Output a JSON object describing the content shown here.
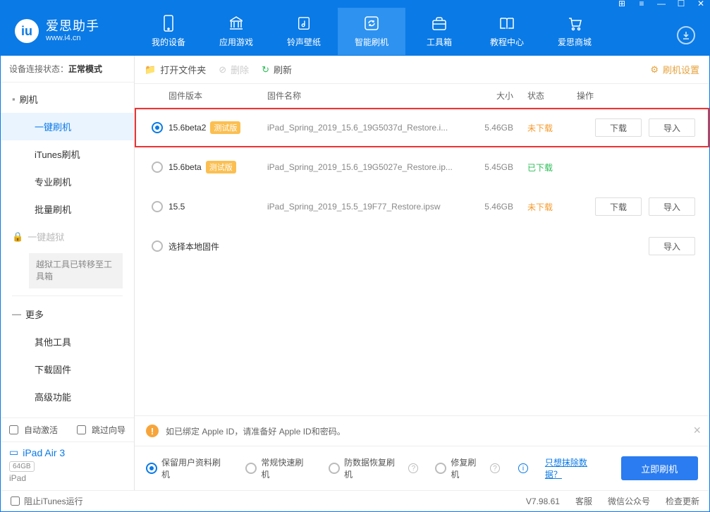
{
  "header": {
    "logo_cn": "爱思助手",
    "logo_url": "www.i4.cn",
    "nav": [
      {
        "label": "我的设备"
      },
      {
        "label": "应用游戏"
      },
      {
        "label": "铃声壁纸"
      },
      {
        "label": "智能刷机"
      },
      {
        "label": "工具箱"
      },
      {
        "label": "教程中心"
      },
      {
        "label": "爱思商城"
      }
    ]
  },
  "sidebar": {
    "status_prefix": "设备连接状态：",
    "status_value": "正常模式",
    "group_flash": "刷机",
    "items_flash": [
      "一键刷机",
      "iTunes刷机",
      "专业刷机",
      "批量刷机"
    ],
    "group_jailbreak": "一键越狱",
    "jailbreak_note": "越狱工具已转移至工具箱",
    "group_more": "更多",
    "items_more": [
      "其他工具",
      "下载固件",
      "高级功能"
    ],
    "cb_auto_activate": "自动激活",
    "cb_skip_guide": "跳过向导",
    "device_name": "iPad Air 3",
    "device_storage": "64GB",
    "device_type": "iPad"
  },
  "toolbar": {
    "open_folder": "打开文件夹",
    "delete": "删除",
    "refresh": "刷新",
    "settings": "刷机设置"
  },
  "table": {
    "head": {
      "version": "固件版本",
      "name": "固件名称",
      "size": "大小",
      "status": "状态",
      "ops": "操作"
    },
    "rows": [
      {
        "version": "15.6beta2",
        "beta": "测试版",
        "name": "iPad_Spring_2019_15.6_19G5037d_Restore.i...",
        "size": "5.46GB",
        "status": "未下载",
        "status_class": "undl",
        "selected": true,
        "highlight": true,
        "download": "下载",
        "import": "导入"
      },
      {
        "version": "15.6beta",
        "beta": "测试版",
        "name": "iPad_Spring_2019_15.6_19G5027e_Restore.ip...",
        "size": "5.45GB",
        "status": "已下载",
        "status_class": "dl",
        "selected": false
      },
      {
        "version": "15.5",
        "name": "iPad_Spring_2019_15.5_19F77_Restore.ipsw",
        "size": "5.46GB",
        "status": "未下载",
        "status_class": "undl",
        "selected": false,
        "download": "下载",
        "import": "导入"
      },
      {
        "version": "",
        "name_as_version": "选择本地固件",
        "import": "导入"
      }
    ]
  },
  "bottom": {
    "warn": "如已绑定 Apple ID，请准备好 Apple ID和密码。",
    "opts": [
      "保留用户资料刷机",
      "常规快速刷机",
      "防数据恢复刷机",
      "修复刷机"
    ],
    "erase_link": "只想抹除数据？",
    "go_button": "立即刷机"
  },
  "footer": {
    "block_itunes": "阻止iTunes运行",
    "version": "V7.98.61",
    "service": "客服",
    "wechat": "微信公众号",
    "update": "检查更新"
  }
}
